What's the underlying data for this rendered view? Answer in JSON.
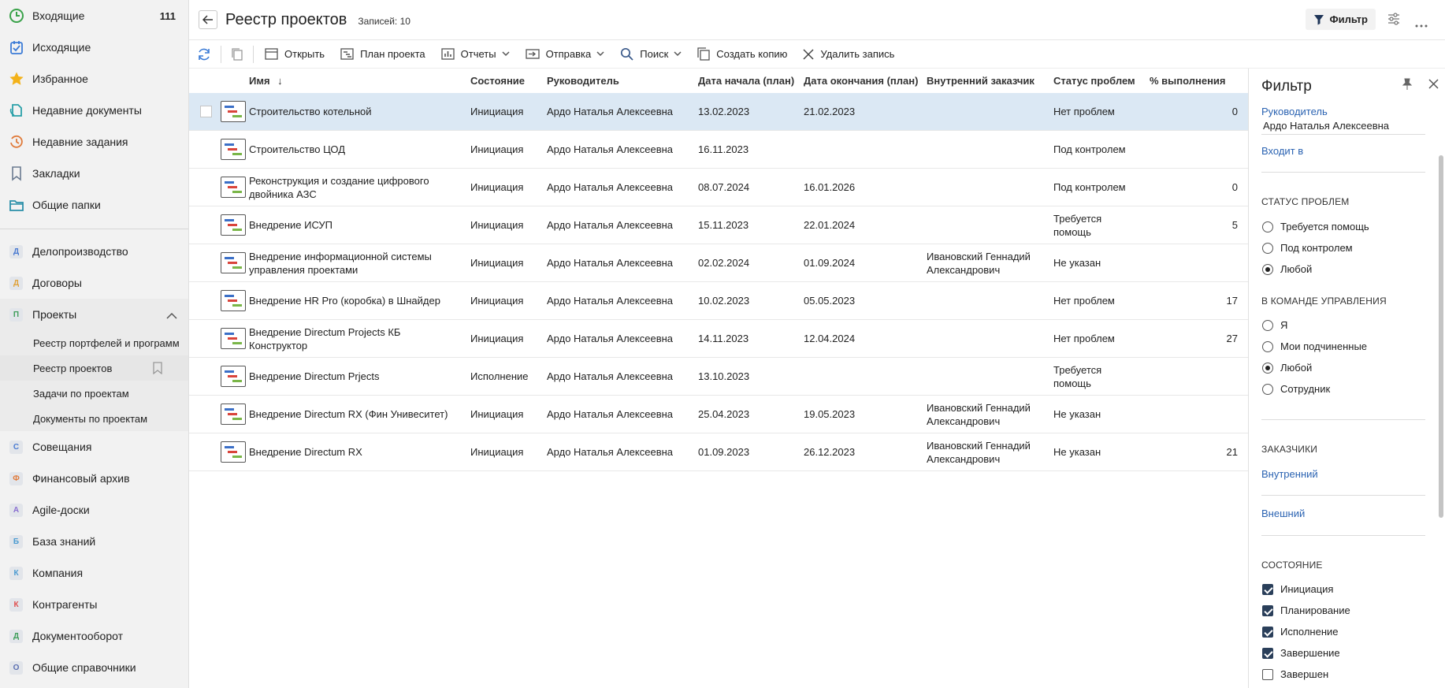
{
  "sidebar": {
    "top_items": [
      {
        "label": "Входящие",
        "count": "111",
        "icon": "clock-icon"
      },
      {
        "label": "Исходящие",
        "icon": "outbox-icon"
      },
      {
        "label": "Избранное",
        "icon": "star-icon"
      },
      {
        "label": "Недавние документы",
        "icon": "recent-docs-icon"
      },
      {
        "label": "Недавние задания",
        "icon": "recent-tasks-icon"
      },
      {
        "label": "Закладки",
        "icon": "bookmark-icon"
      },
      {
        "label": "Общие папки",
        "icon": "folder-icon"
      }
    ],
    "modules": [
      {
        "letter": "Д",
        "label": "Делопроизводство",
        "color": "#4b7bd1"
      },
      {
        "letter": "Д",
        "label": "Договоры",
        "color": "#e0a23a"
      },
      {
        "letter": "П",
        "label": "Проекты",
        "color": "#3f9e5b"
      },
      {
        "letter": "С",
        "label": "Совещания",
        "color": "#4b7bd1"
      },
      {
        "letter": "Ф",
        "label": "Финансовый архив",
        "color": "#e07a3a"
      },
      {
        "letter": "A",
        "label": "Agile-доски",
        "color": "#8a6fd1"
      },
      {
        "letter": "Б",
        "label": "База знаний",
        "color": "#4b9bd1"
      },
      {
        "letter": "К",
        "label": "Компания",
        "color": "#4b9bd1"
      },
      {
        "letter": "К",
        "label": "Контрагенты",
        "color": "#e05050"
      },
      {
        "letter": "Д",
        "label": "Документооборот",
        "color": "#3f9e5b"
      },
      {
        "letter": "О",
        "label": "Общие справочники",
        "color": "#5b6fb1"
      }
    ],
    "sub_items": [
      "Реестр портфелей и программ",
      "Реестр проектов",
      "Задачи по проектам",
      "Документы по проектам"
    ]
  },
  "header": {
    "title": "Реестр проектов",
    "records": "Записей: 10",
    "filter_label": "Фильтр"
  },
  "toolbar": {
    "open": "Открыть",
    "plan": "План проекта",
    "reports": "Отчеты",
    "send": "Отправка",
    "search": "Поиск",
    "copy": "Создать копию",
    "delete": "Удалить запись"
  },
  "table": {
    "columns": {
      "name": "Имя",
      "state": "Состояние",
      "manager": "Руководитель",
      "start": "Дата начала (план)",
      "end": "Дата окончания (план)",
      "customer": "Внутренний заказчик",
      "status": "Статус проблем",
      "percent": "% выполнения"
    },
    "rows": [
      {
        "name": [
          "Строительство котельной"
        ],
        "state": "Инициация",
        "manager": "Ардо Наталья Алексеевна",
        "start": "13.02.2023",
        "end": "21.02.2023",
        "customer": [],
        "status": [
          "Нет проблем"
        ],
        "percent": "0"
      },
      {
        "name": [
          "Строительство ЦОД"
        ],
        "state": "Инициация",
        "manager": "Ардо Наталья Алексеевна",
        "start": "16.11.2023",
        "end": "",
        "customer": [],
        "status": [
          "Под контролем"
        ],
        "percent": ""
      },
      {
        "name": [
          "Реконструкция и создание цифрового",
          "двойника АЗС"
        ],
        "state": "Инициация",
        "manager": "Ардо Наталья Алексеевна",
        "start": "08.07.2024",
        "end": "16.01.2026",
        "customer": [],
        "status": [
          "Под контролем"
        ],
        "percent": "0"
      },
      {
        "name": [
          "Внедрение ИСУП"
        ],
        "state": "Инициация",
        "manager": "Ардо Наталья Алексеевна",
        "start": "15.11.2023",
        "end": "22.01.2024",
        "customer": [],
        "status": [
          "Требуется",
          "помощь"
        ],
        "percent": "5"
      },
      {
        "name": [
          "Внедрение информационной системы",
          "управления проектами"
        ],
        "state": "Инициация",
        "manager": "Ардо Наталья Алексеевна",
        "start": "02.02.2024",
        "end": "01.09.2024",
        "customer": [
          "Ивановский Геннадий",
          "Александрович"
        ],
        "status": [
          "Не указан"
        ],
        "percent": ""
      },
      {
        "name": [
          "Внедрение HR Pro (коробка) в Шнайдер"
        ],
        "state": "Инициация",
        "manager": "Ардо Наталья Алексеевна",
        "start": "10.02.2023",
        "end": "05.05.2023",
        "customer": [],
        "status": [
          "Нет проблем"
        ],
        "percent": "17"
      },
      {
        "name": [
          "Внедрение Directum Projects КБ",
          "Конструктор"
        ],
        "state": "Инициация",
        "manager": "Ардо Наталья Алексеевна",
        "start": "14.11.2023",
        "end": "12.04.2024",
        "customer": [],
        "status": [
          "Нет проблем"
        ],
        "percent": "27"
      },
      {
        "name": [
          "Внедрение Directum Prjects"
        ],
        "state": "Исполнение",
        "manager": "Ардо Наталья Алексеевна",
        "start": "13.10.2023",
        "end": "",
        "customer": [],
        "status": [
          "Требуется",
          "помощь"
        ],
        "percent": ""
      },
      {
        "name": [
          "Внедрение Directum RX (Фин Унивеситет)"
        ],
        "state": "Инициация",
        "manager": "Ардо Наталья Алексеевна",
        "start": "25.04.2023",
        "end": "19.05.2023",
        "customer": [
          "Ивановский Геннадий",
          "Александрович"
        ],
        "status": [
          "Не указан"
        ],
        "percent": ""
      },
      {
        "name": [
          "Внедрение Directum RX"
        ],
        "state": "Инициация",
        "manager": "Ардо Наталья Алексеевна",
        "start": "01.09.2023",
        "end": "26.12.2023",
        "customer": [
          "Ивановский Геннадий",
          "Александрович"
        ],
        "status": [
          "Не указан"
        ],
        "percent": "21"
      }
    ]
  },
  "filter": {
    "title": "Фильтр",
    "manager_link": "Руководитель",
    "manager_value": "Ардо Наталья Алексеевна",
    "includes_link": "Входит в",
    "problem_status_title": "СТАТУС ПРОБЛЕМ",
    "problem_status_options": [
      {
        "label": "Требуется помощь",
        "checked": false
      },
      {
        "label": "Под контролем",
        "checked": false
      },
      {
        "label": "Любой",
        "checked": true
      }
    ],
    "team_title": "В КОМАНДЕ УПРАВЛЕНИЯ",
    "team_options": [
      {
        "label": "Я",
        "checked": false
      },
      {
        "label": "Мои подчиненные",
        "checked": false
      },
      {
        "label": "Любой",
        "checked": true
      },
      {
        "label": "Сотрудник",
        "checked": false
      }
    ],
    "customers_title": "ЗАКАЗЧИКИ",
    "internal_link": "Внутренний",
    "external_link": "Внешний",
    "state_title": "СОСТОЯНИЕ",
    "state_options": [
      {
        "label": "Инициация",
        "checked": true
      },
      {
        "label": "Планирование",
        "checked": true
      },
      {
        "label": "Исполнение",
        "checked": true
      },
      {
        "label": "Завершение",
        "checked": true
      },
      {
        "label": "Завершен",
        "checked": false
      }
    ]
  }
}
